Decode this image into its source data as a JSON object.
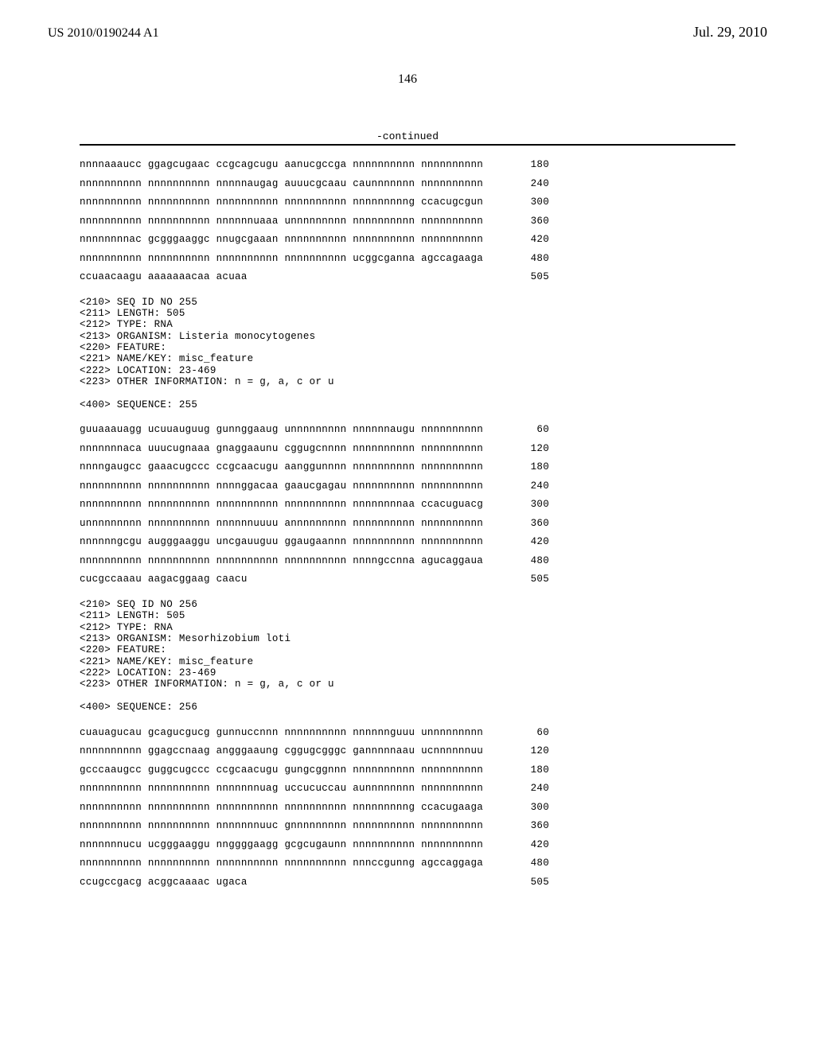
{
  "header": {
    "pub_id": "US 2010/0190244 A1",
    "pub_date": "Jul. 29, 2010"
  },
  "page_number": "146",
  "continued_label": "-continued",
  "seq_block_1": {
    "lines": [
      {
        "text": "nnnnaaaucc ggagcugaac ccgcagcugu aanucgccga nnnnnnnnnn nnnnnnnnnn",
        "num": "180"
      },
      {
        "text": "nnnnnnnnnn nnnnnnnnnn nnnnnaugag auuucgcaau caunnnnnnn nnnnnnnnnn",
        "num": "240"
      },
      {
        "text": "nnnnnnnnnn nnnnnnnnnn nnnnnnnnnn nnnnnnnnnn nnnnnnnnng ccacugcgun",
        "num": "300"
      },
      {
        "text": "nnnnnnnnnn nnnnnnnnnn nnnnnnuaaa unnnnnnnnn nnnnnnnnnn nnnnnnnnnn",
        "num": "360"
      },
      {
        "text": "nnnnnnnnac gcgggaaggc nnugcgaaan nnnnnnnnnn nnnnnnnnnn nnnnnnnnnn",
        "num": "420"
      },
      {
        "text": "nnnnnnnnnn nnnnnnnnnn nnnnnnnnnn nnnnnnnnnn ucggcganna agccagaaga",
        "num": "480"
      },
      {
        "text": "ccuaacaagu aaaaaaacaa acuaa",
        "num": "505"
      }
    ]
  },
  "annotation_255": "<210> SEQ ID NO 255\n<211> LENGTH: 505\n<212> TYPE: RNA\n<213> ORGANISM: Listeria monocytogenes\n<220> FEATURE:\n<221> NAME/KEY: misc_feature\n<222> LOCATION: 23-469\n<223> OTHER INFORMATION: n = g, a, c or u\n\n<400> SEQUENCE: 255",
  "seq_block_255": {
    "lines": [
      {
        "text": "guuaaauagg ucuuauguug gunnggaaug unnnnnnnnn nnnnnnaugu nnnnnnnnnn",
        "num": "60"
      },
      {
        "text": "nnnnnnnaca uuucugnaaa gnaggaaunu cggugcnnnn nnnnnnnnnn nnnnnnnnnn",
        "num": "120"
      },
      {
        "text": "nnnngaugcc gaaacugccc ccgcaacugu aanggunnnn nnnnnnnnnn nnnnnnnnnn",
        "num": "180"
      },
      {
        "text": "nnnnnnnnnn nnnnnnnnnn nnnnggacaa gaaucgagau nnnnnnnnnn nnnnnnnnnn",
        "num": "240"
      },
      {
        "text": "nnnnnnnnnn nnnnnnnnnn nnnnnnnnnn nnnnnnnnnn nnnnnnnnaa ccacuguacg",
        "num": "300"
      },
      {
        "text": "unnnnnnnnn nnnnnnnnnn nnnnnnuuuu annnnnnnnn nnnnnnnnnn nnnnnnnnnn",
        "num": "360"
      },
      {
        "text": "nnnnnngcgu augggaaggu uncgauuguu ggaugaannn nnnnnnnnnn nnnnnnnnnn",
        "num": "420"
      },
      {
        "text": "nnnnnnnnnn nnnnnnnnnn nnnnnnnnnn nnnnnnnnnn nnnngccnna agucaggaua",
        "num": "480"
      },
      {
        "text": "cucgccaaau aagacggaag caacu",
        "num": "505"
      }
    ]
  },
  "annotation_256": "<210> SEQ ID NO 256\n<211> LENGTH: 505\n<212> TYPE: RNA\n<213> ORGANISM: Mesorhizobium loti\n<220> FEATURE:\n<221> NAME/KEY: misc_feature\n<222> LOCATION: 23-469\n<223> OTHER INFORMATION: n = g, a, c or u\n\n<400> SEQUENCE: 256",
  "seq_block_256": {
    "lines": [
      {
        "text": "cuauagucau gcagucgucg gunnuccnnn nnnnnnnnnn nnnnnnguuu unnnnnnnnn",
        "num": "60"
      },
      {
        "text": "nnnnnnnnnn ggagccnaag angggaaung cggugcgggc gannnnnaau ucnnnnnnuu",
        "num": "120"
      },
      {
        "text": "gcccaaugcc guggcugccc ccgcaacugu gungcggnnn nnnnnnnnnn nnnnnnnnnn",
        "num": "180"
      },
      {
        "text": "nnnnnnnnnn nnnnnnnnnn nnnnnnnuag uccucuccau aunnnnnnnn nnnnnnnnnn",
        "num": "240"
      },
      {
        "text": "nnnnnnnnnn nnnnnnnnnn nnnnnnnnnn nnnnnnnnnn nnnnnnnnng ccacugaaga",
        "num": "300"
      },
      {
        "text": "nnnnnnnnnn nnnnnnnnnn nnnnnnnuuc gnnnnnnnnn nnnnnnnnnn nnnnnnnnnn",
        "num": "360"
      },
      {
        "text": "nnnnnnnucu ucgggaaggu nnggggaagg gcgcugaunn nnnnnnnnnn nnnnnnnnnn",
        "num": "420"
      },
      {
        "text": "nnnnnnnnnn nnnnnnnnnn nnnnnnnnnn nnnnnnnnnn nnnccgunng agccaggaga",
        "num": "480"
      },
      {
        "text": "ccugccgacg acggcaaaac ugaca",
        "num": "505"
      }
    ]
  }
}
